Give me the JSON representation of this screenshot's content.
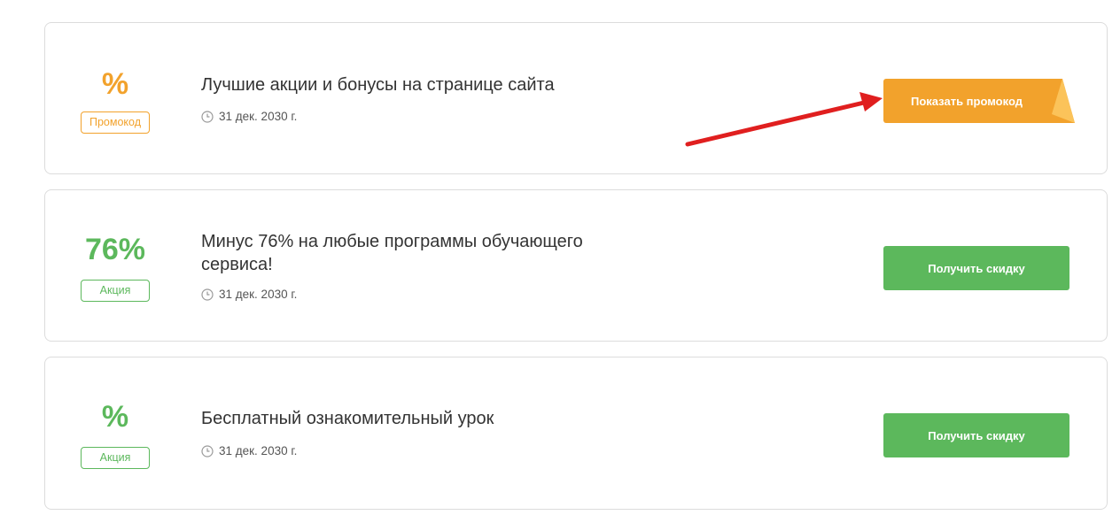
{
  "offers": [
    {
      "value": "%",
      "badge": "Промокод",
      "title": "Лучшие акции и бонусы на странице сайта",
      "date": "31 дек. 2030 г.",
      "button": "Показать промокод",
      "accent": "#f2a22c"
    },
    {
      "value": "76%",
      "badge": "Акция",
      "title": "Минус 76% на любые программы обучающего сервиса!",
      "date": "31 дек. 2030 г.",
      "button": "Получить скидку",
      "accent": "#5cb85c"
    },
    {
      "value": "%",
      "badge": "Акция",
      "title": "Бесплатный ознакомительный урок",
      "date": "31 дек. 2030 г.",
      "button": "Получить скидку",
      "accent": "#5cb85c"
    }
  ],
  "icons": {
    "date": "clock-icon",
    "annotation": "red-arrow-icon"
  },
  "colors": {
    "annotation_arrow": "#e01f1f"
  }
}
